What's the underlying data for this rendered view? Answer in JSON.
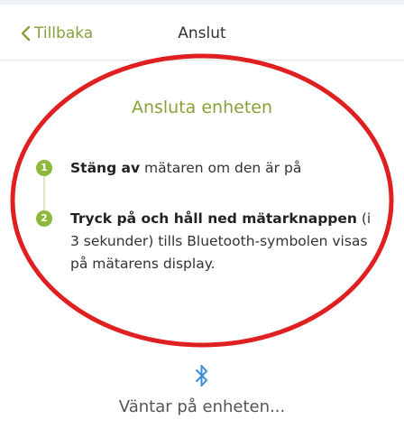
{
  "header": {
    "back_label": "Tillbaka",
    "title": "Anslut"
  },
  "content": {
    "section_title": "Ansluta enheten",
    "steps": [
      {
        "number": "1",
        "bold": "Stäng av",
        "rest": " mätaren om den är på"
      },
      {
        "number": "2",
        "bold": "Tryck på och håll ned mätarknappen",
        "rest": " (i 3 sekunder) tills Bluetooth-symbolen visas på mätarens display."
      }
    ]
  },
  "status": {
    "icon": "bluetooth-icon",
    "text": "Väntar på enheten..."
  },
  "colors": {
    "accent": "#86a23a",
    "step_badge": "#8db83a",
    "bluetooth": "#3a8fd8",
    "annotation": "#e02020"
  }
}
